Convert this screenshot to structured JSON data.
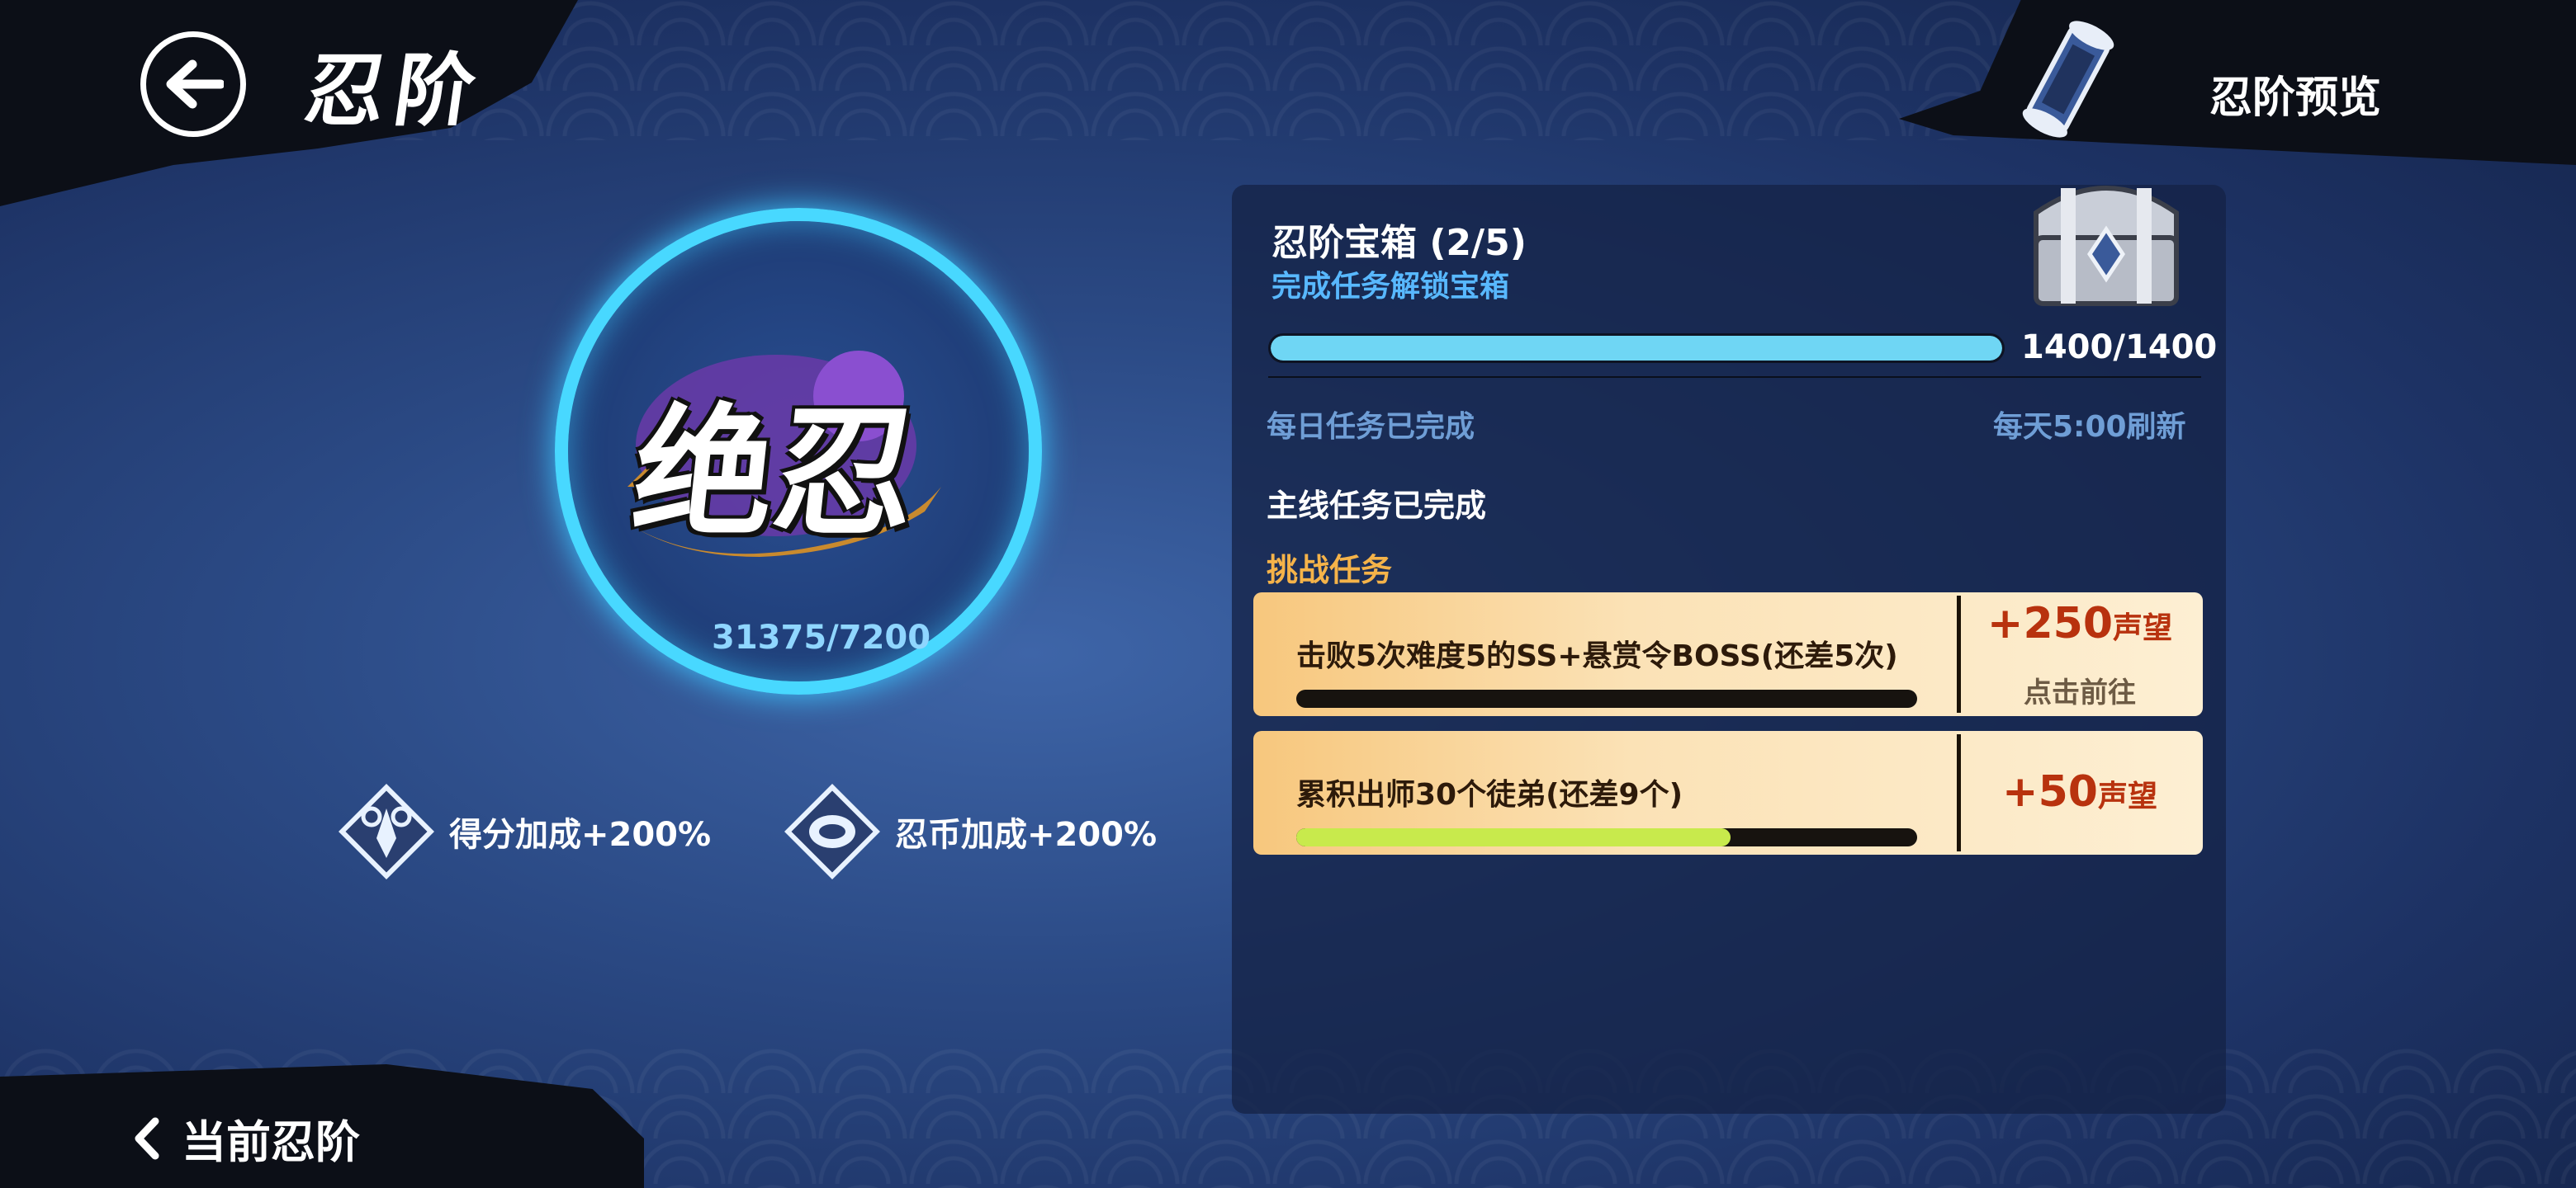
{
  "header": {
    "back_icon": "arrow-left-icon",
    "title": "忍阶",
    "preview_icon": "scroll-icon",
    "preview_label": "忍阶预览"
  },
  "rank": {
    "name": "绝忍",
    "score": "31375/7200",
    "ring_color": "#48d8ff"
  },
  "bonuses": [
    {
      "icon": "kunai-icon",
      "label": "得分加成+200%"
    },
    {
      "icon": "coin-icon",
      "label": "忍币加成+200%"
    }
  ],
  "chest": {
    "title": "忍阶宝箱 (2/5)",
    "subtitle": "完成任务解锁宝箱",
    "icon": "treasure-chest-icon",
    "progress": 1.0,
    "count": "1400/1400"
  },
  "daily": {
    "status": "每日任务已完成",
    "refresh": "每天5:00刷新"
  },
  "main_status": "主线任务已完成",
  "challenge_label": "挑战任务",
  "tasks": [
    {
      "desc": "击败5次难度5的SS+悬赏令BOSS(还差5次)",
      "reward_amount": "+250",
      "reward_unit": "声望",
      "action": "点击前往",
      "progress": 0.0
    },
    {
      "desc": "累积出师30个徒弟(还差9个)",
      "reward_amount": "+50",
      "reward_unit": "声望",
      "progress": 0.7
    }
  ],
  "footer": {
    "chevron_icon": "chevron-left-icon",
    "label": "当前忍阶"
  }
}
